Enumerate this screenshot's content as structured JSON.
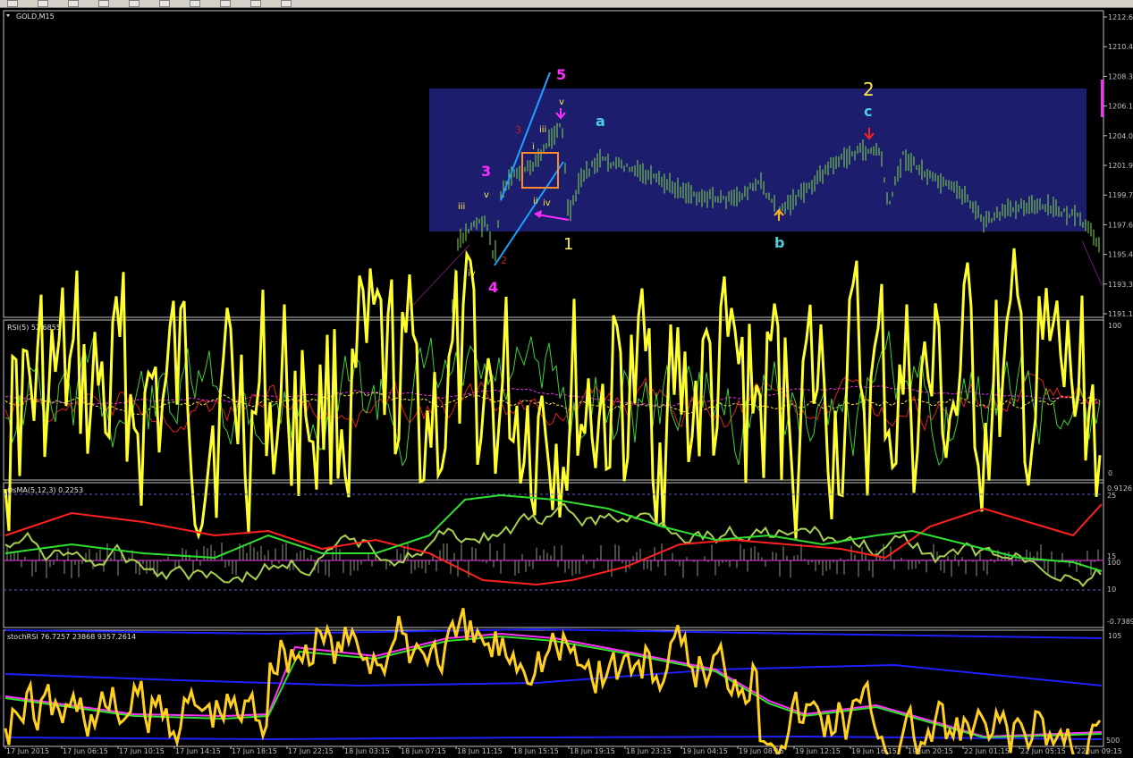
{
  "toolbar": {
    "buttons": [
      "new-chart-icon",
      "profiles-icon",
      "open-icon",
      "save-icon",
      "print-icon",
      "zoom-in-icon",
      "zoom-out-icon",
      "add-icon",
      "navigator-icon",
      "market-watch-icon"
    ]
  },
  "main_pane": {
    "title": "GOLD,M15",
    "price_ticks": [
      "1212.6",
      "1210.4",
      "1208.3",
      "1206.1",
      "1204.0",
      "1201.9",
      "1199.7",
      "1197.6",
      "1195.4",
      "1193.3",
      "1191.1"
    ],
    "wave_labels": {
      "w5": "5",
      "w3": "3",
      "w4": "4",
      "w1": "1",
      "w2": "2",
      "wa": "a",
      "wb": "b",
      "wc": "c",
      "r3": "3",
      "r2": "2",
      "iii_a": "iii",
      "iv_a": "iv",
      "v_a": "v",
      "i_b": "i",
      "ii_b": "ii",
      "iii_b": "iii",
      "iv_b": "iv",
      "v_b": "v"
    },
    "colors": {
      "box": "#1d1d6e",
      "candle": "#7ee04a",
      "channel": "#1ea0ff",
      "wave_main": "#ff2cff",
      "wave_yellow": "#ffe84a",
      "wave_cyan": "#4ad0e0"
    }
  },
  "rsi_pane": {
    "title": "RSI(5) 52.6855",
    "scale_top": "100",
    "scale_bottom": "0"
  },
  "osma_pane": {
    "title": "OsMA(5,12,3) 0.2253",
    "scale_labels": [
      "0.9126",
      "25",
      "15",
      "100",
      "10",
      "-0.7389"
    ]
  },
  "stoch_pane": {
    "title": "stochRSI 76.7257 23868 9357.2614",
    "scale_top": "105",
    "scale_bottom": "500"
  },
  "time_axis": {
    "labels": [
      "17 Jun 2015",
      "17 Jun 06:15",
      "17 Jun 10:15",
      "17 Jun 14:15",
      "17 Jun 18:15",
      "17 Jun 22:15",
      "18 Jun 03:15",
      "18 Jun 07:15",
      "18 Jun 11:15",
      "18 Jun 15:15",
      "18 Jun 19:15",
      "18 Jun 23:15",
      "19 Jun 04:15",
      "19 Jun 08:15",
      "19 Jun 12:15",
      "19 Jun 16:15",
      "19 Jun 20:15",
      "22 Jun 01:15",
      "22 Jun 05:15",
      "22 Jun 09:15"
    ]
  }
}
